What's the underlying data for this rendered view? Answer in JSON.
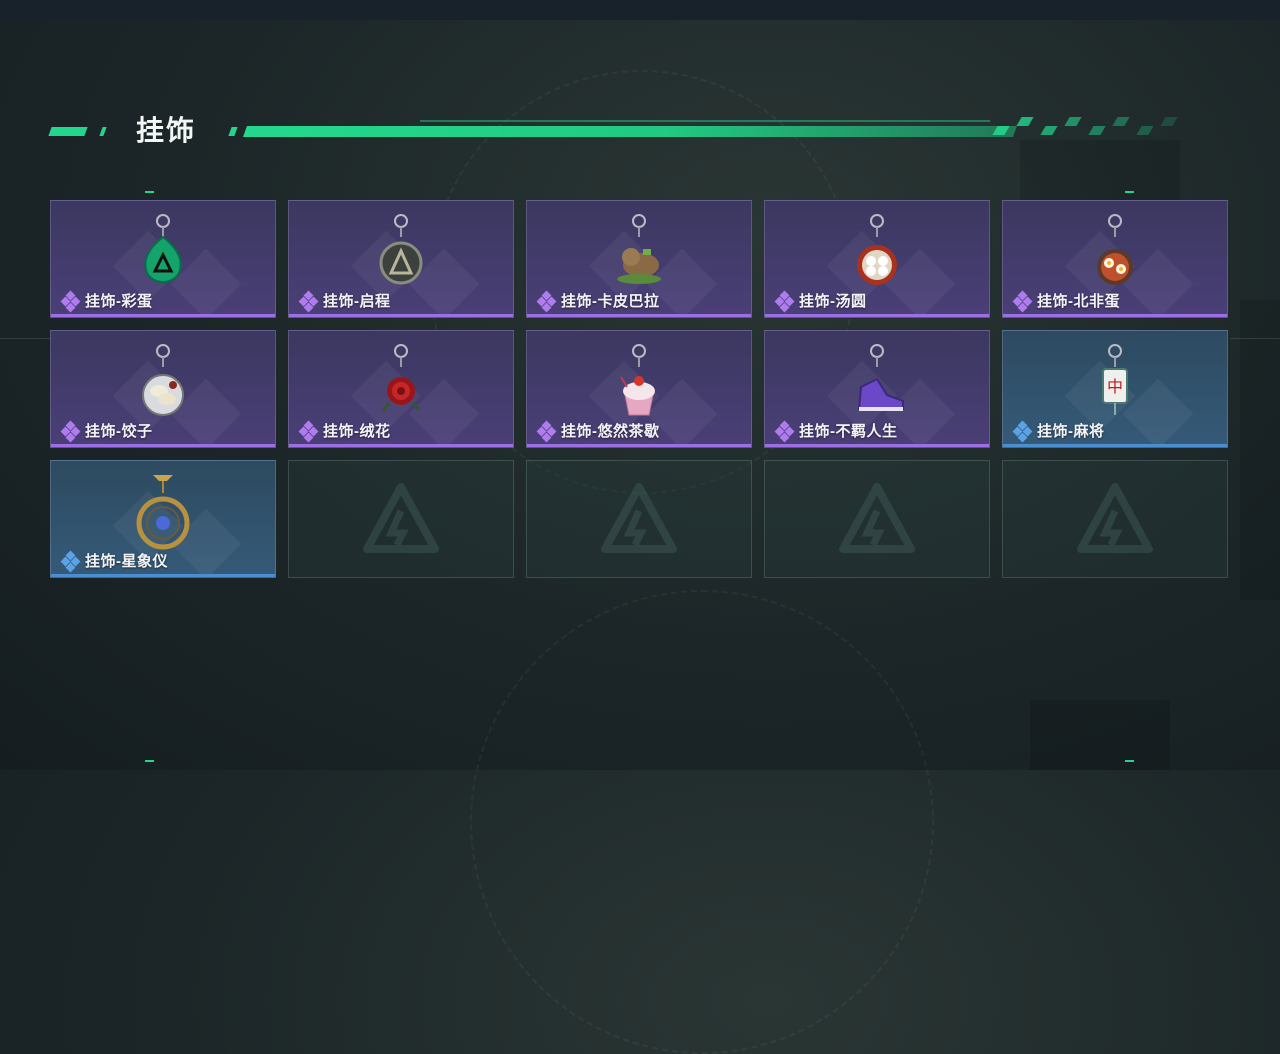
{
  "section": {
    "title": "挂饰"
  },
  "colors": {
    "accent": "#22d68e",
    "rarity_purple": "#9d6ee6",
    "rarity_blue": "#4a8fd4"
  },
  "items": [
    {
      "label": "挂饰-彩蛋",
      "rarity": "purple",
      "icon": "green-logo-drop-charm-icon"
    },
    {
      "label": "挂饰-启程",
      "rarity": "purple",
      "icon": "dark-logo-medal-charm-icon"
    },
    {
      "label": "挂饰-卡皮巴拉",
      "rarity": "purple",
      "icon": "capybara-charm-icon"
    },
    {
      "label": "挂饰-汤圆",
      "rarity": "purple",
      "icon": "tangyuan-bowl-charm-icon"
    },
    {
      "label": "挂饰-北非蛋",
      "rarity": "purple",
      "icon": "shakshuka-charm-icon"
    },
    {
      "label": "挂饰-饺子",
      "rarity": "purple",
      "icon": "dumpling-plate-charm-icon"
    },
    {
      "label": "挂饰-绒花",
      "rarity": "purple",
      "icon": "red-rose-charm-icon"
    },
    {
      "label": "挂饰-悠然茶歇",
      "rarity": "purple",
      "icon": "cupcake-charm-icon"
    },
    {
      "label": "挂饰-不羁人生",
      "rarity": "purple",
      "icon": "purple-sneaker-charm-icon"
    },
    {
      "label": "挂饰-麻将",
      "rarity": "blue",
      "icon": "mahjong-tile-charm-icon"
    },
    {
      "label": "挂饰-星象仪",
      "rarity": "blue",
      "icon": "astrolabe-charm-icon"
    }
  ],
  "empty_slots": 4
}
